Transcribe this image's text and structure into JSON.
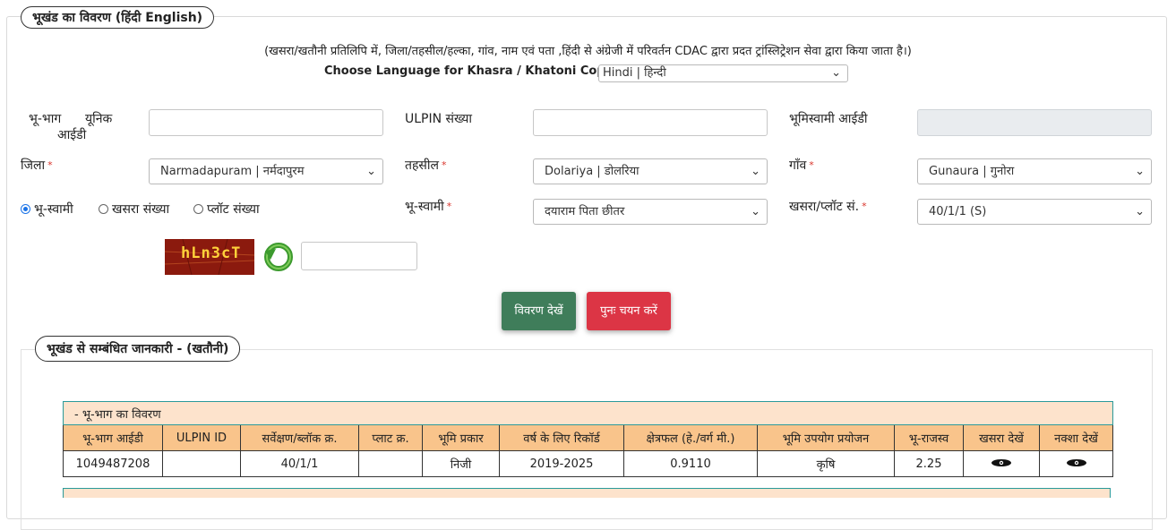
{
  "section1": {
    "legend": "भूखंड का विवरण  (हिंदी   English)"
  },
  "note": "(खसरा/खतौनी प्रतिलिपि में, जिला/तहसील/हल्का, गांव, नाम एवं पता ,हिंदी से अंग्रेजी में परिवर्तन CDAC द्वारा प्रदत ट्रांस्लिट्रेशन सेवा द्वारा किया जाता है।)",
  "language": {
    "label": "Choose Language for Khasra / Khatoni Copy:",
    "selected": "Hindi | हिन्दी"
  },
  "fields": {
    "bhubhag_label_line1": "भू-भाग      यूनिक",
    "bhubhag_label_line2": "आईडी",
    "ulpin_label": "ULPIN संख्या",
    "bhoomiswami_id_label": "भूमिस्वामी आईडी",
    "jila_label": "जिला",
    "jila_value": "Narmadapuram | नर्मदापुरम",
    "tehsil_label": "तहसील",
    "tehsil_value": "Dolariya | डोलरिया",
    "gaon_label": "गाँव",
    "gaon_value": "Gunaura | गुनोरा",
    "bhuswami_label": "भू-स्वामी",
    "bhuswami_value": "दयाराम पिता छीतर",
    "khasra_plot_label": "खसरा/प्लॉट सं.",
    "khasra_plot_value": "40/1/1 (S)",
    "required_mark": "*"
  },
  "radios": [
    {
      "label": "भू-स्वामी",
      "checked": true
    },
    {
      "label": "खसरा संख्या",
      "checked": false
    },
    {
      "label": "प्लॉट संख्या",
      "checked": false
    }
  ],
  "captcha": {
    "text": "hLn3cT"
  },
  "buttons": {
    "view": "विवरण देखें",
    "reset": "पुनः चयन करें"
  },
  "section2": {
    "legend": "भूखंड से सम्बंधित जानकारी -   (खतौनी)"
  },
  "table": {
    "caption": "- भू-भाग का विवरण",
    "headers": [
      "भू-भाग आईडी",
      "ULPIN ID",
      "सर्वेक्षण/ब्लॉक क्र.",
      "प्लाट क्र.",
      "भूमि प्रकार",
      "वर्ष के लिए रिकॉर्ड",
      "क्षेत्रफल (हे./वर्ग मी.)",
      "भूमि उपयोग प्रयोजन",
      "भू-राजस्व",
      "खसरा देखें",
      "नक्शा देखें"
    ],
    "row": [
      "1049487208",
      "",
      "40/1/1",
      "",
      "निजी",
      "2019-2025",
      "0.9110",
      "कृषि",
      "2.25"
    ]
  },
  "colors": {
    "green": "#3f7d5a",
    "red": "#dc3545",
    "header": "#f9c48b",
    "caption": "#fde3cc",
    "captcha_bg": "#8b1a0e"
  }
}
